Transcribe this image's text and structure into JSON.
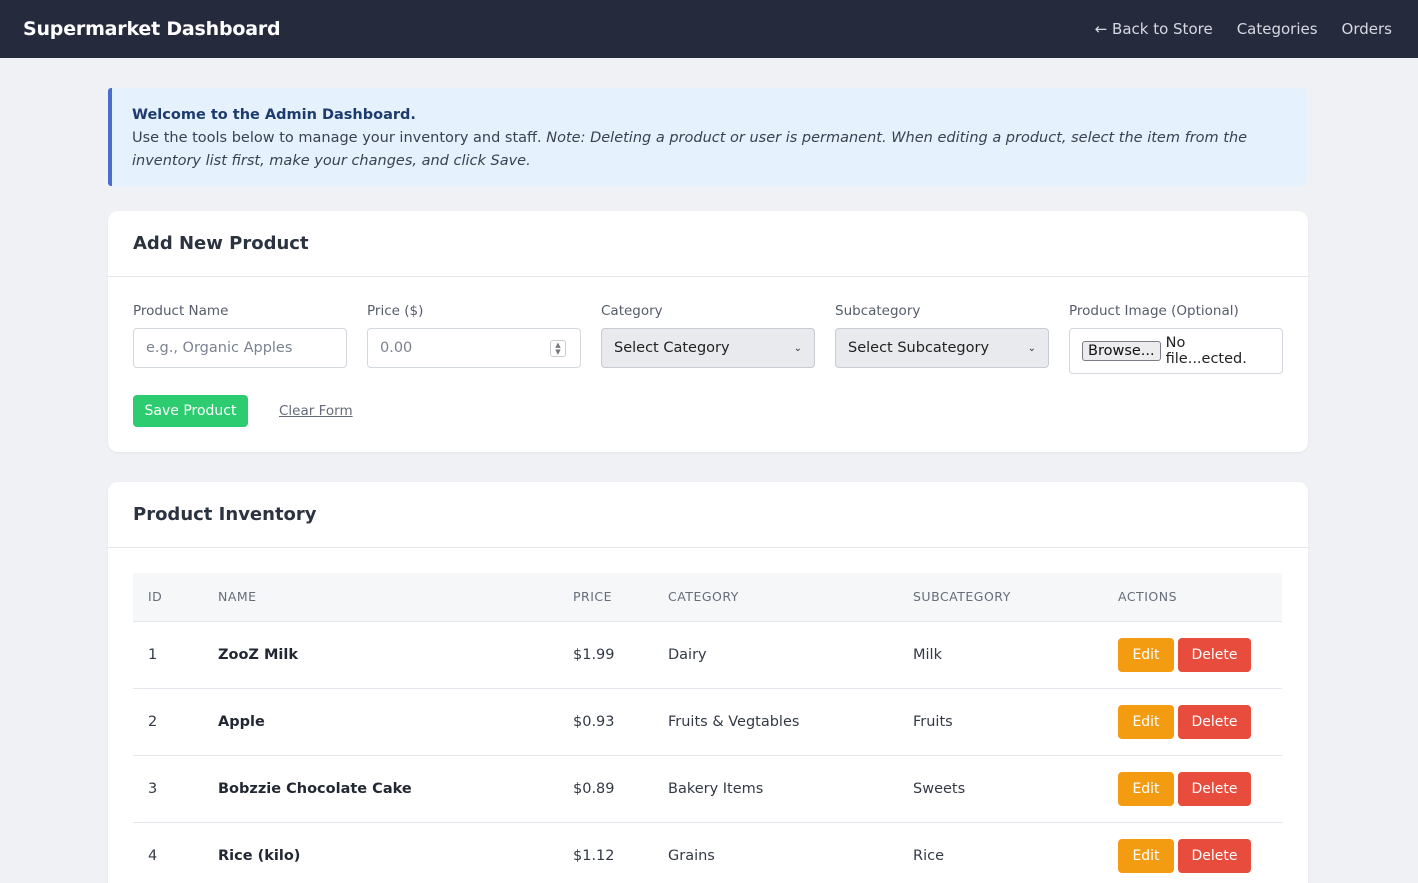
{
  "header": {
    "brand": "Supermarket Dashboard",
    "nav": [
      "← Back to Store",
      "Categories",
      "Orders"
    ]
  },
  "notice": {
    "title": "Welcome to the Admin Dashboard.",
    "text": "Use the tools below to manage your inventory and staff. ",
    "note": "Note: Deleting a product or user is permanent. When editing a product, select the item from the inventory list first, make your changes, and click Save."
  },
  "add_product": {
    "title": "Add New Product",
    "name_label": "Product Name",
    "name_placeholder": "e.g., Organic Apples",
    "price_label": "Price ($)",
    "price_placeholder": "0.00",
    "category_label": "Category",
    "category_value": "Select Category",
    "subcategory_label": "Subcategory",
    "subcategory_value": "Select Subcategory",
    "image_label": "Product Image (Optional)",
    "browse_label": "Browse...",
    "file_status": "No file...ected.",
    "save_label": "Save Product",
    "clear_label": "Clear Form"
  },
  "inventory": {
    "title": "Product Inventory",
    "columns": [
      "ID",
      "Name",
      "Price",
      "Category",
      "Subcategory",
      "Actions"
    ],
    "edit_label": "Edit",
    "delete_label": "Delete",
    "rows": [
      {
        "id": "1",
        "name": "ZooZ Milk",
        "price": "$1.99",
        "category": "Dairy",
        "subcategory": "Milk"
      },
      {
        "id": "2",
        "name": "Apple",
        "price": "$0.93",
        "category": "Fruits & Vegtables",
        "subcategory": "Fruits"
      },
      {
        "id": "3",
        "name": "Bobzzie Chocolate Cake",
        "price": "$0.89",
        "category": "Bakery Items",
        "subcategory": "Sweets"
      },
      {
        "id": "4",
        "name": "Rice (kilo)",
        "price": "$1.12",
        "category": "Grains",
        "subcategory": "Rice"
      }
    ]
  }
}
